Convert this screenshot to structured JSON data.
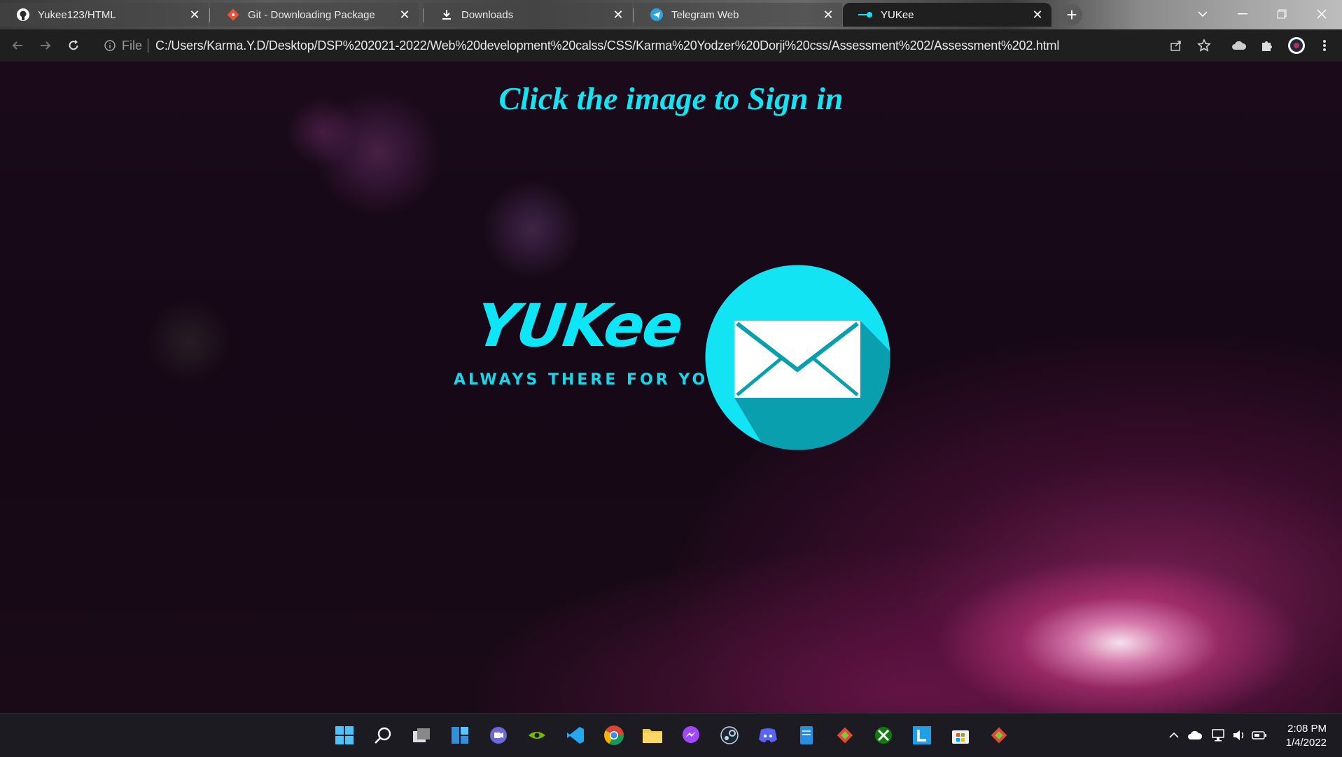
{
  "browser": {
    "tabs": [
      {
        "title": "Yukee123/HTML",
        "icon": "github-icon",
        "active": false
      },
      {
        "title": "Git - Downloading Package",
        "icon": "git-icon",
        "active": false
      },
      {
        "title": "Downloads",
        "icon": "download-icon",
        "active": false
      },
      {
        "title": "Telegram Web",
        "icon": "telegram-icon",
        "active": false
      },
      {
        "title": "YUKee",
        "icon": "yukee-favicon-icon",
        "active": true
      }
    ],
    "address": {
      "scheme_label": "File",
      "url": "C:/Users/Karma.Y.D/Desktop/DSP%202021-2022/Web%20development%20calss/CSS/Karma%20Yodzer%20Dorji%20css/Assessment%202/Assessment%202.html"
    }
  },
  "page": {
    "heading": "Click the image to Sign in",
    "logo": {
      "wordmark": "YUKee",
      "tagline": "ALWAYS THERE FOR YOU",
      "accent_color": "#0de6f6",
      "circle_color": "#12e4f4",
      "shadow_color": "#0a9fae"
    }
  },
  "taskbar": {
    "apps": [
      "windows-start-icon",
      "search-icon",
      "task-view-icon",
      "widgets-icon",
      "teams-chat-icon",
      "nvidia-icon",
      "vscode-icon",
      "chrome-icon",
      "file-explorer-icon",
      "messenger-icon",
      "steam-icon",
      "discord-icon",
      "notepad-icon",
      "git-gui-icon",
      "xbox-icon",
      "launcher-l-icon",
      "microsoft-store-icon",
      "git-gui-icon-2"
    ],
    "clock": {
      "time": "2:08 PM",
      "date": "1/4/2022"
    }
  }
}
